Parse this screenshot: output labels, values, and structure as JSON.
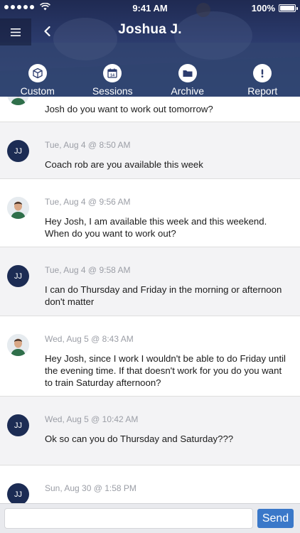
{
  "status_bar": {
    "time": "9:41 AM",
    "battery": "100%"
  },
  "header": {
    "title": "Joshua J."
  },
  "tabs": [
    {
      "label": "Custom",
      "icon": "cube-icon"
    },
    {
      "label": "Sessions",
      "icon": "calendar-icon",
      "badge": "14"
    },
    {
      "label": "Archive",
      "icon": "folder-icon"
    },
    {
      "label": "Report",
      "icon": "alert-icon"
    }
  ],
  "messages": [
    {
      "avatar": "photo",
      "time": "",
      "text": "Josh do you want to work out tomorrow?"
    },
    {
      "avatar": "JJ",
      "time": "Tue, Aug 4 @ 8:50 AM",
      "text": "Coach rob are you available this week"
    },
    {
      "avatar": "photo",
      "time": "Tue, Aug 4 @ 9:56 AM",
      "text": "Hey Josh, I am available this week and this weekend. When do you want to work out?"
    },
    {
      "avatar": "JJ",
      "time": "Tue, Aug 4 @ 9:58 AM",
      "text": "I can do Thursday and Friday in the morning or afternoon don't matter"
    },
    {
      "avatar": "photo",
      "time": "Wed, Aug 5 @ 8:43 AM",
      "text": "Hey Josh, since I work I wouldn't be able to do Friday until the evening time. If that doesn't work for you do you want to train Saturday afternoon?"
    },
    {
      "avatar": "JJ",
      "time": "Wed, Aug 5 @ 10:42 AM",
      "text": "Ok so can you do Thursday and Saturday???"
    },
    {
      "avatar": "JJ",
      "time": "Sun, Aug 30 @ 1:58 PM",
      "text": ""
    }
  ],
  "composer": {
    "value": "",
    "placeholder": "",
    "send_label": "Send"
  },
  "colors": {
    "header": "#2c3c6e",
    "avatar": "#1c2c54",
    "send": "#3a78c9",
    "alt_row": "#f3f3f5"
  }
}
